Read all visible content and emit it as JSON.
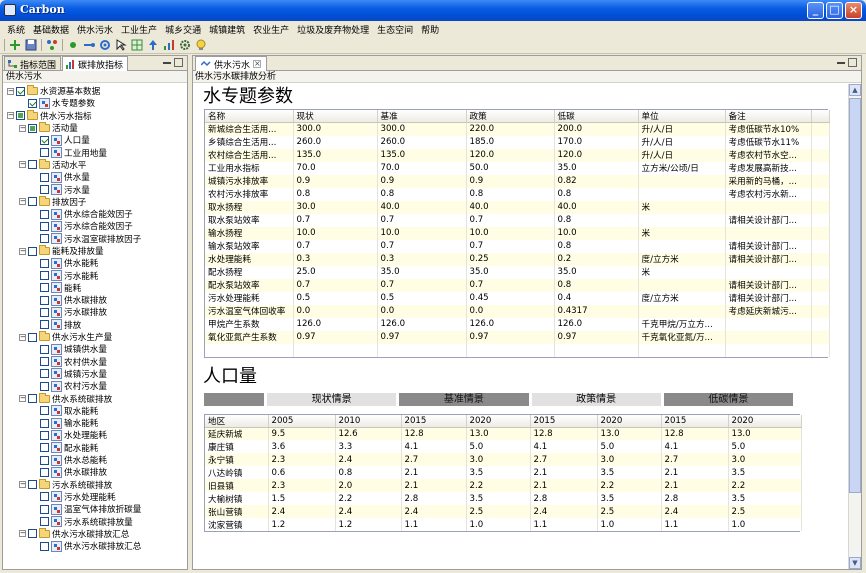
{
  "window": {
    "title": "Carbon",
    "minimize": "_",
    "maximize": "□",
    "close": "×"
  },
  "menu": [
    "系统",
    "基础数据",
    "供水污水",
    "工业生产",
    "城乡交通",
    "城镇建筑",
    "农业生产",
    "垃圾及废弃物处理",
    "生态空间",
    "帮助"
  ],
  "left": {
    "tabs": [
      "指标范围",
      "碳排放指标"
    ],
    "label": "供水污水",
    "tree": [
      {
        "level": 0,
        "exp": "−",
        "cb": "checked",
        "icon": "folder",
        "text": "水资源基本数据"
      },
      {
        "level": 1,
        "exp": "",
        "cb": "checked",
        "icon": "leaf",
        "text": "水专题参数"
      },
      {
        "level": 0,
        "exp": "−",
        "cb": "partial",
        "icon": "folder",
        "text": "供水污水指标"
      },
      {
        "level": 1,
        "exp": "−",
        "cb": "partial",
        "icon": "folder",
        "text": "活动量"
      },
      {
        "level": 2,
        "exp": "",
        "cb": "checked",
        "icon": "leaf",
        "text": "人口量"
      },
      {
        "level": 2,
        "exp": "",
        "cb": "",
        "icon": "leaf",
        "text": "工业用地量"
      },
      {
        "level": 1,
        "exp": "−",
        "cb": "",
        "icon": "folder",
        "text": "活动水平"
      },
      {
        "level": 2,
        "exp": "",
        "cb": "",
        "icon": "leaf",
        "text": "供水量"
      },
      {
        "level": 2,
        "exp": "",
        "cb": "",
        "icon": "leaf",
        "text": "污水量"
      },
      {
        "level": 1,
        "exp": "−",
        "cb": "",
        "icon": "folder",
        "text": "排放因子"
      },
      {
        "level": 2,
        "exp": "",
        "cb": "",
        "icon": "leaf",
        "text": "供水综合能效因子"
      },
      {
        "level": 2,
        "exp": "",
        "cb": "",
        "icon": "leaf",
        "text": "污水综合能效因子"
      },
      {
        "level": 2,
        "exp": "",
        "cb": "",
        "icon": "leaf",
        "text": "污水温室碳排放因子"
      },
      {
        "level": 1,
        "exp": "−",
        "cb": "",
        "icon": "folder",
        "text": "能耗及排放量"
      },
      {
        "level": 2,
        "exp": "",
        "cb": "",
        "icon": "leaf",
        "text": "供水能耗"
      },
      {
        "level": 2,
        "exp": "",
        "cb": "",
        "icon": "leaf",
        "text": "污水能耗"
      },
      {
        "level": 2,
        "exp": "",
        "cb": "",
        "icon": "leaf",
        "text": "能耗"
      },
      {
        "level": 2,
        "exp": "",
        "cb": "",
        "icon": "leaf",
        "text": "供水碳排放"
      },
      {
        "level": 2,
        "exp": "",
        "cb": "",
        "icon": "leaf",
        "text": "污水碳排放"
      },
      {
        "level": 2,
        "exp": "",
        "cb": "",
        "icon": "leaf",
        "text": "排放"
      },
      {
        "level": 1,
        "exp": "−",
        "cb": "",
        "icon": "folder",
        "text": "供水污水生产量"
      },
      {
        "level": 2,
        "exp": "",
        "cb": "",
        "icon": "leaf",
        "text": "城镇供水量"
      },
      {
        "level": 2,
        "exp": "",
        "cb": "",
        "icon": "leaf",
        "text": "农村供水量"
      },
      {
        "level": 2,
        "exp": "",
        "cb": "",
        "icon": "leaf",
        "text": "城镇污水量"
      },
      {
        "level": 2,
        "exp": "",
        "cb": "",
        "icon": "leaf",
        "text": "农村污水量"
      },
      {
        "level": 1,
        "exp": "−",
        "cb": "",
        "icon": "folder",
        "text": "供水系统碳排放"
      },
      {
        "level": 2,
        "exp": "",
        "cb": "",
        "icon": "leaf",
        "text": "取水能耗"
      },
      {
        "level": 2,
        "exp": "",
        "cb": "",
        "icon": "leaf",
        "text": "输水能耗"
      },
      {
        "level": 2,
        "exp": "",
        "cb": "",
        "icon": "leaf",
        "text": "水处理能耗"
      },
      {
        "level": 2,
        "exp": "",
        "cb": "",
        "icon": "leaf",
        "text": "配水能耗"
      },
      {
        "level": 2,
        "exp": "",
        "cb": "",
        "icon": "leaf",
        "text": "供水总能耗"
      },
      {
        "level": 2,
        "exp": "",
        "cb": "",
        "icon": "leaf",
        "text": "供水碳排放"
      },
      {
        "level": 1,
        "exp": "−",
        "cb": "",
        "icon": "folder",
        "text": "污水系统碳排放"
      },
      {
        "level": 2,
        "exp": "",
        "cb": "",
        "icon": "leaf",
        "text": "污水处理能耗"
      },
      {
        "level": 2,
        "exp": "",
        "cb": "",
        "icon": "leaf",
        "text": "温室气体排放折碳量"
      },
      {
        "level": 2,
        "exp": "",
        "cb": "",
        "icon": "leaf",
        "text": "污水系统碳排放量"
      },
      {
        "level": 1,
        "exp": "−",
        "cb": "",
        "icon": "folder",
        "text": "供水污水碳排放汇总"
      },
      {
        "level": 2,
        "exp": "",
        "cb": "",
        "icon": "leaf",
        "text": "供水污水碳排放汇总"
      }
    ]
  },
  "right": {
    "tab": "供水污水",
    "subtitle": "供水污水碳排放分析",
    "water": {
      "title": "水专题参数",
      "columns": [
        "名称",
        "现状",
        "基准",
        "政策",
        "低碳",
        "单位",
        "备注"
      ],
      "rows": [
        [
          "新城综合生活用...",
          "300.0",
          "300.0",
          "220.0",
          "200.0",
          "升/人/日",
          "考虑低碳节水10%"
        ],
        [
          "乡镇综合生活用...",
          "260.0",
          "260.0",
          "185.0",
          "170.0",
          "升/人/日",
          "考虑低碳节水11%"
        ],
        [
          "农村综合生活用...",
          "135.0",
          "135.0",
          "120.0",
          "120.0",
          "升/人/日",
          "考虑农村节水空..."
        ],
        [
          "工业用水指标",
          "70.0",
          "70.0",
          "50.0",
          "35.0",
          "立方米/公顷/日",
          "考虑发展高新技..."
        ],
        [
          "城镇污水排放率",
          "0.9",
          "0.9",
          "0.9",
          "0.82",
          "",
          "采用新的马桶，..."
        ],
        [
          "农村污水排放率",
          "0.8",
          "0.8",
          "0.8",
          "0.8",
          "",
          "考虑农村污水新..."
        ],
        [
          "取水扬程",
          "30.0",
          "40.0",
          "40.0",
          "40.0",
          "米",
          ""
        ],
        [
          "取水泵站效率",
          "0.7",
          "0.7",
          "0.7",
          "0.8",
          "",
          "请相关设计部门..."
        ],
        [
          "输水扬程",
          "10.0",
          "10.0",
          "10.0",
          "10.0",
          "米",
          ""
        ],
        [
          "输水泵站效率",
          "0.7",
          "0.7",
          "0.7",
          "0.8",
          "",
          "请相关设计部门..."
        ],
        [
          "水处理能耗",
          "0.3",
          "0.3",
          "0.25",
          "0.2",
          "度/立方米",
          "请相关设计部门..."
        ],
        [
          "配水扬程",
          "25.0",
          "35.0",
          "35.0",
          "35.0",
          "米",
          ""
        ],
        [
          "配水泵站效率",
          "0.7",
          "0.7",
          "0.7",
          "0.8",
          "",
          "请相关设计部门..."
        ],
        [
          "污水处理能耗",
          "0.5",
          "0.5",
          "0.45",
          "0.4",
          "度/立方米",
          "请相关设计部门..."
        ],
        [
          "污水温室气体回收率",
          "0.0",
          "0.0",
          "0.0",
          "0.4317",
          "",
          "考虑延庆新城污..."
        ],
        [
          "甲烷产生系数",
          "126.0",
          "126.0",
          "126.0",
          "126.0",
          "千克甲烷/万立方...",
          ""
        ],
        [
          "氧化亚氮产生系数",
          "0.97",
          "0.97",
          "0.97",
          "0.97",
          "千克氧化亚氮/万...",
          ""
        ],
        [
          "",
          "",
          "",
          "",
          "",
          "",
          ""
        ]
      ]
    },
    "population": {
      "title": "人口量",
      "scenarios": [
        "",
        "现状情景",
        "基准情景",
        "政策情景",
        "低碳情景"
      ],
      "columns": [
        "地区",
        "2005",
        "2010",
        "2015",
        "2020",
        "2015",
        "2020",
        "2015",
        "2020"
      ],
      "rows": [
        [
          "延庆新城",
          "9.5",
          "12.6",
          "12.8",
          "13.0",
          "12.8",
          "13.0",
          "12.8",
          "13.0"
        ],
        [
          "康庄镇",
          "3.6",
          "3.3",
          "4.1",
          "5.0",
          "4.1",
          "5.0",
          "4.1",
          "5.0"
        ],
        [
          "永宁镇",
          "2.3",
          "2.4",
          "2.7",
          "3.0",
          "2.7",
          "3.0",
          "2.7",
          "3.0"
        ],
        [
          "八达岭镇",
          "0.6",
          "0.8",
          "2.1",
          "3.5",
          "2.1",
          "3.5",
          "2.1",
          "3.5"
        ],
        [
          "旧县镇",
          "2.3",
          "2.0",
          "2.1",
          "2.2",
          "2.1",
          "2.2",
          "2.1",
          "2.2"
        ],
        [
          "大榆树镇",
          "1.5",
          "2.2",
          "2.8",
          "3.5",
          "2.8",
          "3.5",
          "2.8",
          "3.5"
        ],
        [
          "张山营镇",
          "2.4",
          "2.4",
          "2.4",
          "2.5",
          "2.4",
          "2.5",
          "2.4",
          "2.5"
        ],
        [
          "沈家营镇",
          "1.2",
          "1.2",
          "1.1",
          "1.0",
          "1.1",
          "1.0",
          "1.1",
          "1.0"
        ]
      ]
    }
  }
}
